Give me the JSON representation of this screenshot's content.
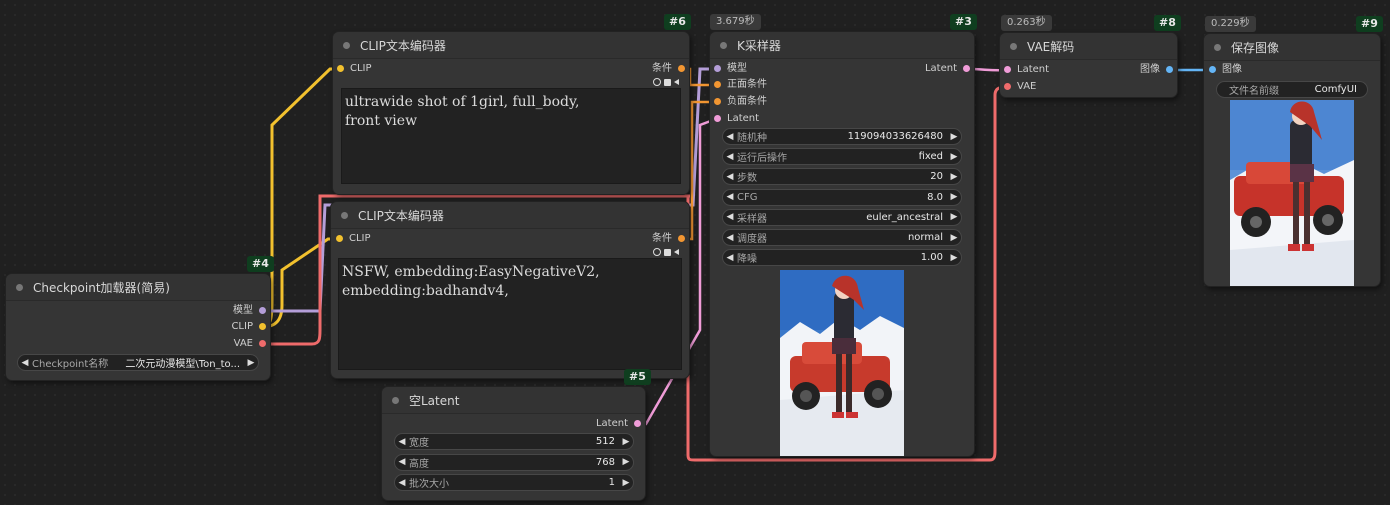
{
  "colors": {
    "clip": "#f2c12e",
    "model": "#b49ed8",
    "vae": "#ef6b6b",
    "cond": "#f29632",
    "latent": "#f09cd8",
    "image": "#64b5f6"
  },
  "nodes": {
    "clip_pos": {
      "id": "#6",
      "title": "CLIP文本编码器",
      "in_clip": "CLIP",
      "out_cond": "条件",
      "text": "ultrawide shot of 1girl, full_body,\nfront view"
    },
    "clip_neg": {
      "title": "CLIP文本编码器",
      "in_clip": "CLIP",
      "out_cond": "条件",
      "text": "NSFW, embedding:EasyNegativeV2,\nembedding:badhandv4,"
    },
    "checkpoint": {
      "id": "#4",
      "title": "Checkpoint加载器(简易)",
      "out_model": "模型",
      "out_clip": "CLIP",
      "out_vae": "VAE",
      "widget_label": "Checkpoint名称",
      "widget_value": "二次元动漫模型\\Ton_to..."
    },
    "latent": {
      "id": "#5",
      "title": "空Latent",
      "out_latent": "Latent",
      "widgets": [
        {
          "label": "宽度",
          "value": "512"
        },
        {
          "label": "高度",
          "value": "768"
        },
        {
          "label": "批次大小",
          "value": "1"
        }
      ]
    },
    "ksampler": {
      "id": "#3",
      "time": "3.679秒",
      "title": "K采样器",
      "in_model": "模型",
      "in_pos": "正面条件",
      "in_neg": "负面条件",
      "in_latent": "Latent",
      "out_latent": "Latent",
      "widgets": [
        {
          "label": "随机种",
          "value": "119094033626480"
        },
        {
          "label": "运行后操作",
          "value": "fixed"
        },
        {
          "label": "步数",
          "value": "20"
        },
        {
          "label": "CFG",
          "value": "8.0"
        },
        {
          "label": "采样器",
          "value": "euler_ancestral"
        },
        {
          "label": "调度器",
          "value": "normal"
        },
        {
          "label": "降噪",
          "value": "1.00"
        }
      ]
    },
    "vae_decode": {
      "id": "#8",
      "time": "0.263秒",
      "title": "VAE解码",
      "in_latent": "Latent",
      "in_vae": "VAE",
      "out_image": "图像"
    },
    "save_image": {
      "id": "#9",
      "time": "0.229秒",
      "title": "保存图像",
      "in_image": "图像",
      "widget_label": "文件名前缀",
      "widget_value": "ComfyUI"
    }
  }
}
